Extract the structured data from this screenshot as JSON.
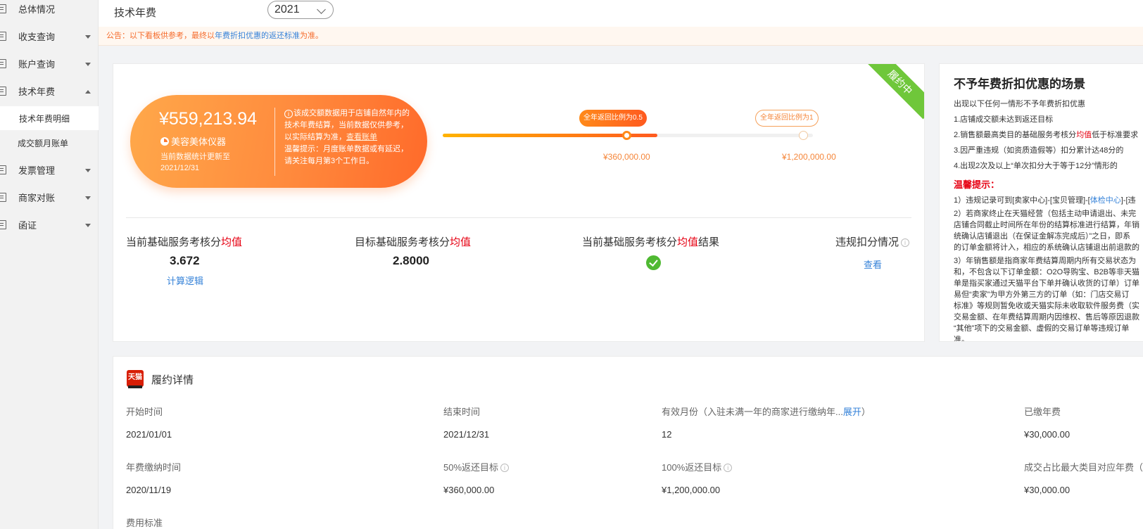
{
  "sidebar": {
    "items": [
      {
        "label": "总体情况"
      },
      {
        "label": "收支查询"
      },
      {
        "label": "账户查询"
      },
      {
        "label": "技术年费"
      },
      {
        "label": "发票管理"
      },
      {
        "label": "商家对账"
      },
      {
        "label": "函证"
      }
    ],
    "subitems": [
      {
        "label": "技术年费明细"
      },
      {
        "label": "成交额月账单"
      }
    ]
  },
  "topbar": {
    "title": "技术年费",
    "year": "2021"
  },
  "notice": {
    "prefix": "公告：以下看板供参考，最终以",
    "link": "年费折扣优惠的返还标准",
    "suffix": "为准。"
  },
  "summary": {
    "status": "履约中",
    "amount": "¥559,213.94",
    "shop": "美容美体仪器",
    "update_line1": "当前数据统计更新至",
    "update_date": "2021/12/31",
    "note_icon": "i",
    "note_text": "该成交额数据用于店铺自然年内的技术年费结算，当前数据仅供参考，以实际结算为准，",
    "note_link": "查看账单",
    "note_tip": "温馨提示：月度账单数据或有延迟，请关注每月第3个工作日。",
    "progress": 0.58,
    "milestone1_tag": "全年返回比例为0.5",
    "milestone1_amount": "¥360,000.00",
    "milestone2_tag": "全年返回比例为1",
    "milestone2_amount": "¥1,200,000.00"
  },
  "metrics": {
    "m1_prefix": "当前基础服务考核分",
    "m1_red": "均值",
    "m1_value": "3.672",
    "m1_link": "计算逻辑",
    "m2_prefix": "目标基础服务考核分",
    "m2_red": "均值",
    "m2_value": "2.8000",
    "m3_prefix": "当前基础服务考核分",
    "m3_red": "均值",
    "m3_suffix": "结果",
    "m4_label": "违规扣分情况",
    "m4_link": "查看",
    "info": "i"
  },
  "rules": {
    "title": "不予年费折扣优惠的场景",
    "intro": "出现以下任何一情形不予年费折扣优惠",
    "r1": "1.店铺成交额未达到返还目标",
    "r2_prefix": "2.销售额最高类目的基础服务考核分",
    "r2_red": "均值",
    "r2_suffix": "低于标准要求",
    "r3": "3.因严重违规（如资质造假等）扣分累计达48分的",
    "r4": "4.出现2次及以上“单次扣分大于等于12分”情形的",
    "warm": "温馨提示：",
    "w1_prefix": "1）违规记录可到[卖家中心]-[宝贝管理]-[",
    "w1_link": "体检中心",
    "w1_suffix": "]-[违",
    "w2_l1": "2）若商家终止在天猫经营（包括主动申请退出、未完",
    "w2_l2": "店铺合同截止时间所在年份的结算标准进行结算，年销",
    "w2_l3": "统确认店铺退出（在保证金解冻完成后）”之日，即系",
    "w2_l4": "的订单金额将计入，相应的系统确认店铺退出前退款的",
    "w3_l1": "3）年销售额是指商家年费结算周期内所有交易状态为",
    "w3_l2": "和，不包含以下订单金额：O2O导购宝、B2B等非天猫",
    "w3_l3": "单是指买家通过天猫平台下单并确认收货的订单）订单",
    "w3_l4": "易但“卖家”为甲方外第三方的订单（如：门店交易订",
    "w3_l5": "标准》等规则暂免收或天猫实际未收取软件服务费（实",
    "w3_l6": "交易金额、在年费结算周期内因维权、售后等原因退款",
    "w3_l7": "“其他”项下的交易金额、虚假的交易订单等违规订单",
    "w3_l8": "准。"
  },
  "details": {
    "logo_text": "天猫",
    "title": "履约详情",
    "start_label": "开始时间",
    "start_value": "2021/01/01",
    "end_label": "结束时间",
    "end_value": "2021/12/31",
    "months_label": "有效月份（入驻未满一年的商家进行缴纳年...",
    "months_link": "展开",
    "months_suffix": "）",
    "months_value": "12",
    "paid_label": "已缴年费",
    "paid_value": "¥30,000.00",
    "paytime_label": "年费缴纳时间",
    "paytime_value": "2020/11/19",
    "t50_label": "50%返还目标",
    "t50_value": "¥360,000.00",
    "t100_label": "100%返还目标",
    "t100_value": "¥1,200,000.00",
    "maxcat_label": "成交占比最大类目对应年费（",
    "maxcat_value": "¥30,000.00",
    "fee_std_label": "费用标准",
    "info": "i"
  },
  "colors": {
    "accent": "#ff8a3d",
    "link": "#3582d8",
    "success": "#4fb932",
    "ribbon": "#6fc73a",
    "warning_red": "#e60012"
  }
}
